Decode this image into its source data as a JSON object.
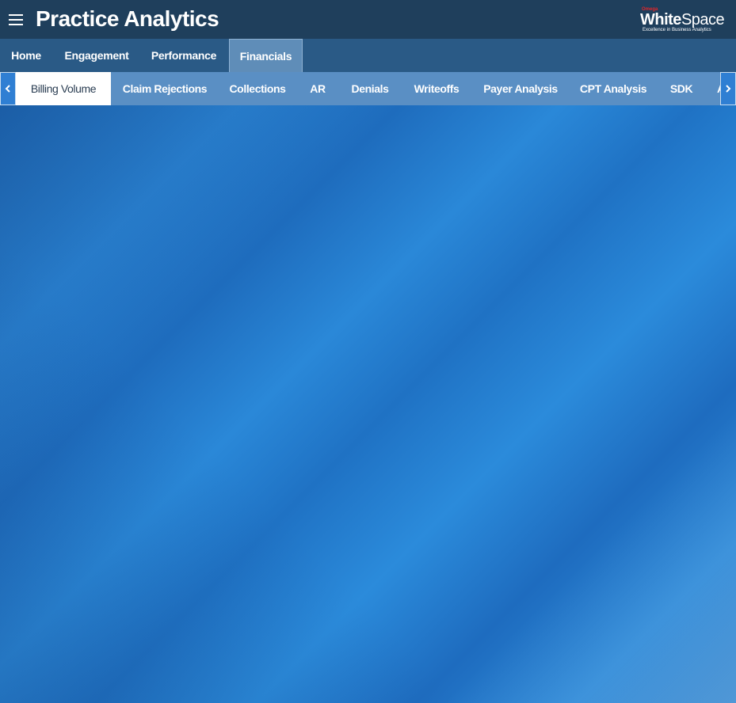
{
  "header": {
    "app_title": "Practice Analytics",
    "logo": {
      "brand": "Omega",
      "word1": "White",
      "word2": "Space",
      "tagline": "Excellence in Business Analytics"
    }
  },
  "primary_nav": {
    "tabs": [
      {
        "label": "Home",
        "active": false
      },
      {
        "label": "Engagement",
        "active": false
      },
      {
        "label": "Performance",
        "active": false
      },
      {
        "label": "Financials",
        "active": true
      }
    ]
  },
  "secondary_nav": {
    "tabs": [
      {
        "label": "Billing Volume",
        "active": true
      },
      {
        "label": "Claim Rejections",
        "active": false
      },
      {
        "label": "Collections",
        "active": false
      },
      {
        "label": "AR",
        "active": false
      },
      {
        "label": "Denials",
        "active": false
      },
      {
        "label": "Writeoffs",
        "active": false
      },
      {
        "label": "Payer Analysis",
        "active": false
      },
      {
        "label": "CPT Analysis",
        "active": false
      },
      {
        "label": "SDK",
        "active": false
      },
      {
        "label": "A",
        "active": false
      }
    ]
  },
  "colors": {
    "header_bg": "#1f3f5c",
    "primary_nav_bg": "#2a5a86",
    "secondary_nav_bg": "#5a8fc4",
    "content_bg": "#1f6fbe",
    "logo_brand": "#e2262a"
  },
  "icons": {
    "menu": "hamburger-menu-icon",
    "scroll_left": "chevron-left-icon",
    "scroll_right": "chevron-right-icon"
  }
}
